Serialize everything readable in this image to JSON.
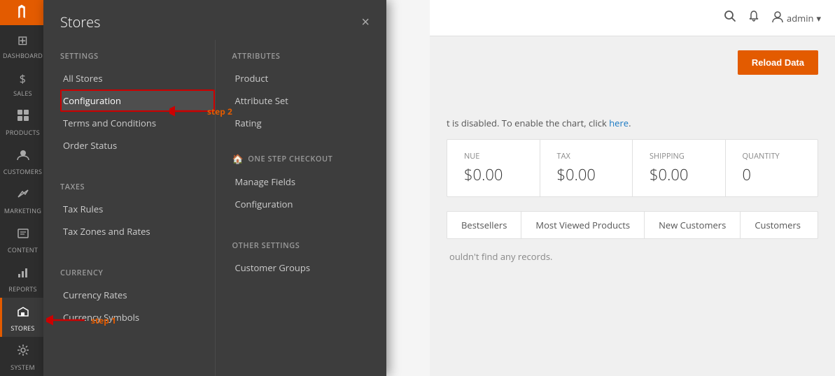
{
  "sidebar": {
    "logo_alt": "Magento",
    "items": [
      {
        "id": "dashboard",
        "label": "DASHBOARD",
        "icon": "⊞"
      },
      {
        "id": "sales",
        "label": "SALES",
        "icon": "$"
      },
      {
        "id": "products",
        "label": "PRODUCTS",
        "icon": "📦"
      },
      {
        "id": "customers",
        "label": "CUSTOMERS",
        "icon": "👤"
      },
      {
        "id": "marketing",
        "label": "MARKETING",
        "icon": "📢"
      },
      {
        "id": "content",
        "label": "CONTENT",
        "icon": "▣"
      },
      {
        "id": "reports",
        "label": "REPORTS",
        "icon": "📊"
      },
      {
        "id": "stores",
        "label": "STORES",
        "icon": "🏪",
        "active": true
      },
      {
        "id": "system",
        "label": "SYSTEM",
        "icon": "⚙"
      }
    ]
  },
  "stores_panel": {
    "title": "Stores",
    "close_button": "×",
    "left_column": {
      "settings_section": {
        "title": "Settings",
        "items": [
          {
            "label": "All Stores",
            "highlighted": false
          },
          {
            "label": "Configuration",
            "highlighted": true
          },
          {
            "label": "Terms and Conditions",
            "highlighted": false
          },
          {
            "label": "Order Status",
            "highlighted": false
          }
        ]
      },
      "taxes_section": {
        "title": "Taxes",
        "items": [
          {
            "label": "Tax Rules"
          },
          {
            "label": "Tax Zones and Rates"
          }
        ]
      },
      "currency_section": {
        "title": "Currency",
        "items": [
          {
            "label": "Currency Rates"
          },
          {
            "label": "Currency Symbols"
          }
        ]
      }
    },
    "right_column": {
      "attributes_section": {
        "title": "Attributes",
        "items": [
          {
            "label": "Product"
          },
          {
            "label": "Attribute Set"
          },
          {
            "label": "Rating"
          }
        ]
      },
      "one_step_checkout_section": {
        "title": "One Step Checkout",
        "house_icon": "🏠",
        "items": [
          {
            "label": "Manage Fields"
          },
          {
            "label": "Configuration"
          }
        ]
      },
      "other_settings_section": {
        "title": "Other Settings",
        "items": [
          {
            "label": "Customer Groups"
          }
        ]
      }
    }
  },
  "annotations": {
    "step1_label": "step 1",
    "step2_label": "step 2"
  },
  "topbar": {
    "search_icon": "🔍",
    "bell_icon": "🔔",
    "user_icon": "👤",
    "username": "admin",
    "dropdown_icon": "▾"
  },
  "dashboard": {
    "reload_button": "Reload Data",
    "chart_disabled_msg": "t is disabled. To enable the chart, click",
    "chart_link_text": "here",
    "stats": [
      {
        "label": "nue",
        "value": "$0.00"
      },
      {
        "label": "Tax",
        "value": "$0.00"
      },
      {
        "label": "Shipping",
        "value": "$0.00"
      },
      {
        "label": "Quantity",
        "value": "0"
      }
    ],
    "tabs": [
      {
        "id": "bestsellers",
        "label": "Bestsellers",
        "active": false
      },
      {
        "id": "most-viewed",
        "label": "Most Viewed Products",
        "active": false
      },
      {
        "id": "new-customers",
        "label": "New Customers",
        "active": false
      },
      {
        "id": "customers",
        "label": "Customers",
        "active": false
      }
    ],
    "no_records_msg": "ouldn't find any records."
  }
}
